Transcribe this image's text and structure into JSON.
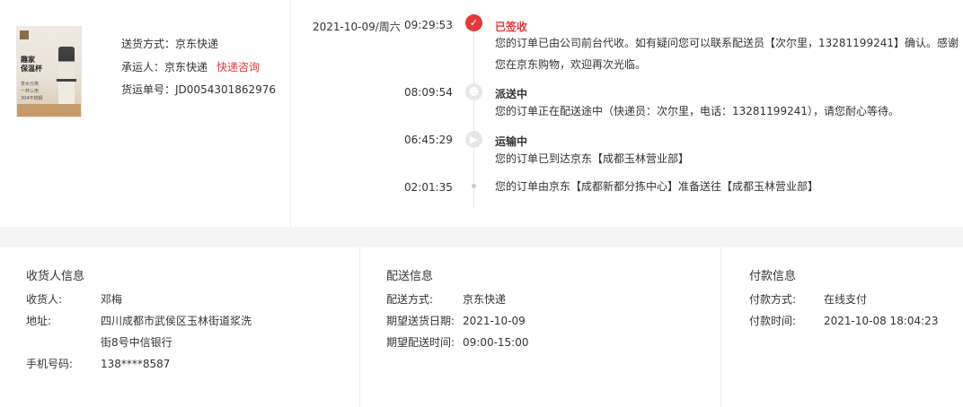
{
  "product": {
    "image_label": "趣家\n保温杯",
    "image_sub": "茶水分离\n一杯三用\n304不锈钢",
    "image_brand": "QJ"
  },
  "shipping": {
    "method_label": "送货方式：",
    "method_value": "京东快递",
    "carrier_label": "承运人：",
    "carrier_value": "京东快递",
    "consult_link": "快递咨询",
    "tracking_label": "货运单号：",
    "tracking_value": "JD0054301862976"
  },
  "timeline": [
    {
      "date": "2021-10-09/周六",
      "time": "09:29:53",
      "icon": "check-icon",
      "title": "已签收",
      "desc": "您的订单已由公司前台代收。如有疑问您可以联系配送员【次尔里，13281199241】确认。感谢您在京东购物，欢迎再次光临。"
    },
    {
      "date": "",
      "time": "08:09:54",
      "icon": "delivery-person-icon",
      "title": "派送中",
      "desc": "您的订单正在配送途中（快递员：次尔里，电话：13281199241），请您耐心等待。"
    },
    {
      "date": "",
      "time": "06:45:29",
      "icon": "truck-icon",
      "title": "运输中",
      "desc": "您的订单已到达京东【成都玉林营业部】"
    },
    {
      "date": "",
      "time": "02:01:35",
      "icon": "dot-icon",
      "title": "",
      "desc": "您的订单由京东【成都新都分拣中心】准备送往【成都玉林营业部】"
    }
  ],
  "receiver": {
    "section_title": "收货人信息",
    "name_label": "收货人:",
    "name_value": "邓梅",
    "address_label": "地址:",
    "address_line1": "四川成都市武侯区玉林街道浆洗",
    "address_line2": "街8号中信银行",
    "phone_label": "手机号码:",
    "phone_value": "138****8587"
  },
  "delivery": {
    "section_title": "配送信息",
    "method_label": "配送方式:",
    "method_value": "京东快递",
    "date_label": "期望送货日期:",
    "date_value": "2021-10-09",
    "time_label": "期望配送时间:",
    "time_value": "09:00-15:00"
  },
  "payment": {
    "section_title": "付款信息",
    "method_label": "付款方式:",
    "method_value": "在线支付",
    "time_label": "付款时间:",
    "time_value": "2021-10-08 18:04:23"
  },
  "colors": {
    "accent": "#e4393c",
    "divider_bg": "#f5f5f5"
  }
}
